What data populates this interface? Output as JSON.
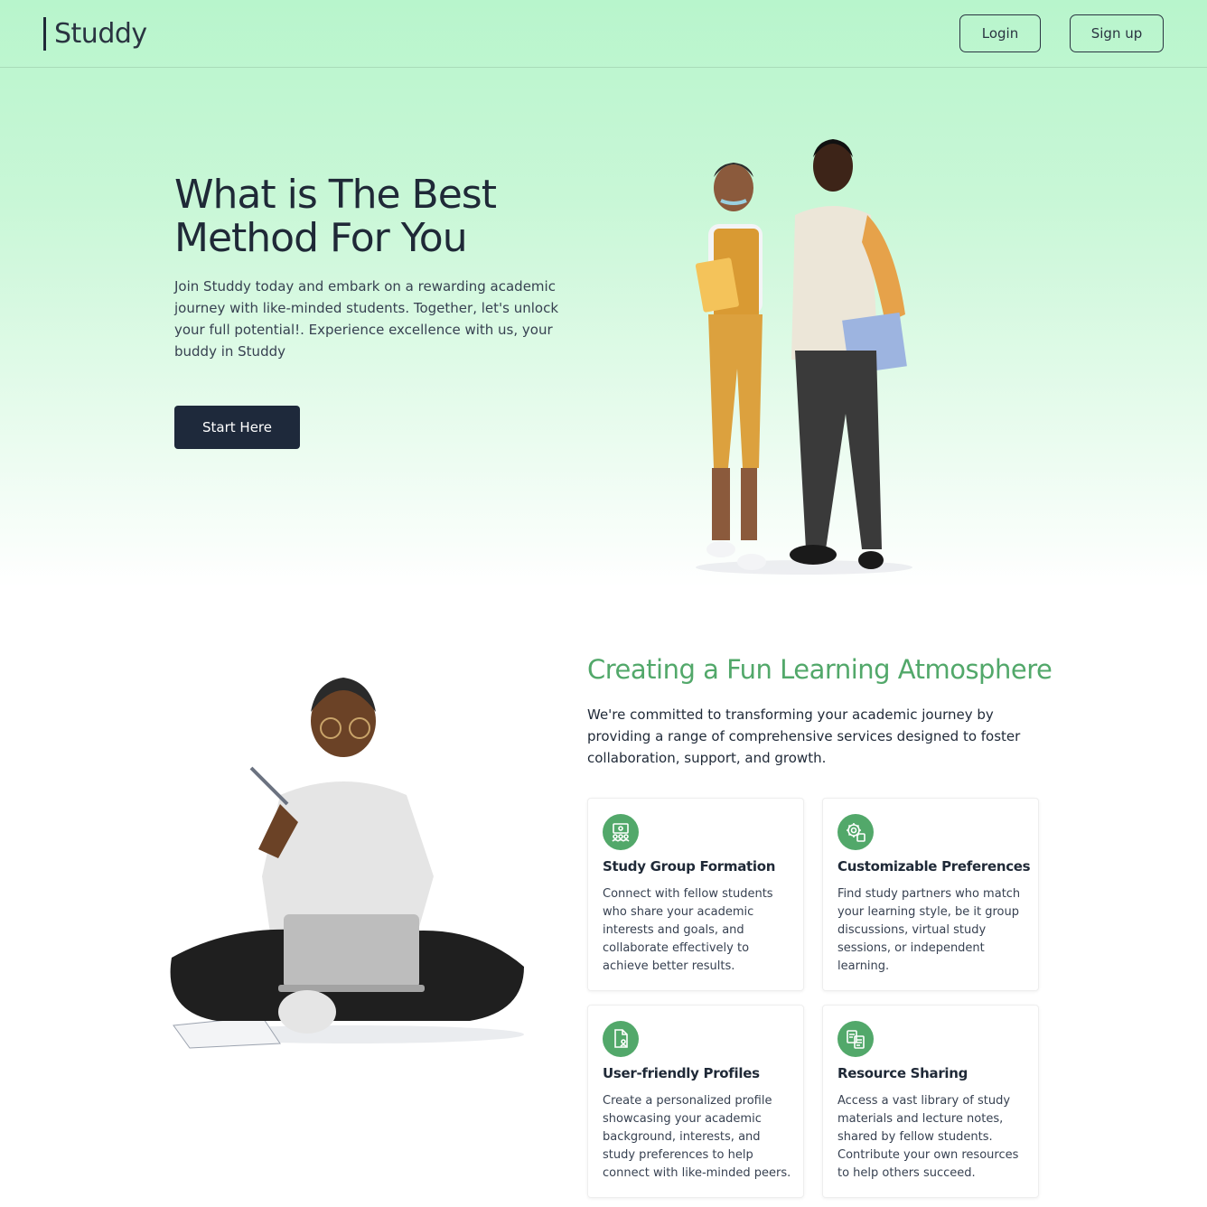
{
  "header": {
    "logo_text": "Studdy",
    "login_label": "Login",
    "signup_label": "Sign up"
  },
  "hero": {
    "title": "What is The Best Method For You",
    "description": "Join Studdy today and embark on a rewarding academic journey with like-minded students. Together, let's unlock your full potential!. Experience excellence with us, your buddy in Studdy",
    "cta_label": "Start Here"
  },
  "features": {
    "title": "Creating a Fun Learning Atmosphere",
    "description": "We're committed to transforming your academic journey by providing a range of comprehensive services designed to foster collaboration, support, and growth.",
    "cards": [
      {
        "icon": "study-group-icon",
        "title": "Study Group Formation",
        "text": "Connect with fellow students who share your academic interests and goals, and collaborate effectively to achieve better results."
      },
      {
        "icon": "preferences-icon",
        "title": "Customizable Preferences",
        "text": "Find study partners who match your learning style, be it group discussions, virtual study sessions, or independent learning."
      },
      {
        "icon": "profile-icon",
        "title": "User-friendly Profiles",
        "text": "Create a personalized profile showcasing your academic background, interests, and study preferences to help connect with like-minded peers."
      },
      {
        "icon": "resource-sharing-icon",
        "title": "Resource Sharing",
        "text": "Access a vast library of study materials and lecture notes, shared by fellow students. Contribute your own resources to help others succeed."
      }
    ]
  },
  "colors": {
    "accent": "#52a86a",
    "dark": "#1e293b",
    "hero_bg": "#b8f5cc"
  }
}
